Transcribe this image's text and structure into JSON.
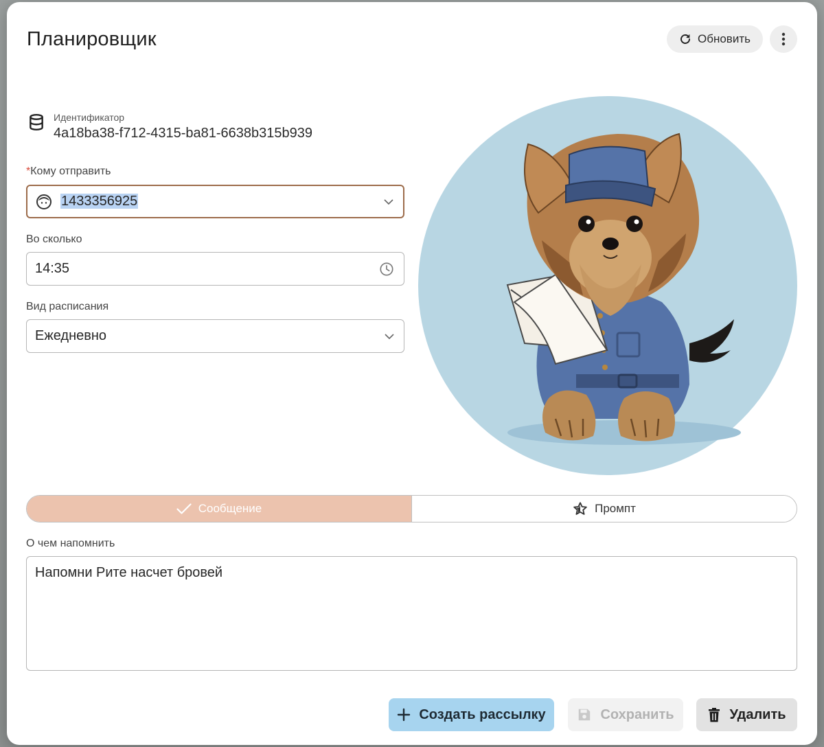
{
  "header": {
    "title": "Планировщик",
    "refresh_label": "Обновить"
  },
  "identifier": {
    "label": "Идентификатор",
    "value": "4a18ba38-f712-4315-ba81-6638b315b939"
  },
  "recipient": {
    "required_mark": "*",
    "label": "Кому отправить",
    "value": "1433356925"
  },
  "time": {
    "label": "Во сколько",
    "value": "14:35"
  },
  "schedule": {
    "label": "Вид расписания",
    "value": "Ежедневно"
  },
  "mode_toggle": {
    "options": [
      {
        "label": "Сообщение",
        "selected": true
      },
      {
        "label": "Промпт",
        "selected": false
      }
    ]
  },
  "reminder": {
    "label": "О чем напомнить",
    "value": "Напомни Рите насчет бровей"
  },
  "actions": {
    "create_label": "Создать рассылку",
    "save_label": "Сохранить",
    "delete_label": "Удалить"
  },
  "icons": {
    "refresh": "refresh-icon",
    "more": "more-vertical-icon",
    "identifier": "database-icon",
    "recipient": "user-face-icon",
    "time": "clock-icon",
    "message": "check-icon",
    "prompt": "star-icon",
    "create": "plus-icon",
    "save": "floppy-disk-icon",
    "delete": "trash-icon"
  },
  "colors": {
    "toggle_active": "#ecc3ae",
    "create_button": "#a7d4ef",
    "focused_border": "#9c6b4a",
    "avatar_background": "#b8d6e3"
  }
}
